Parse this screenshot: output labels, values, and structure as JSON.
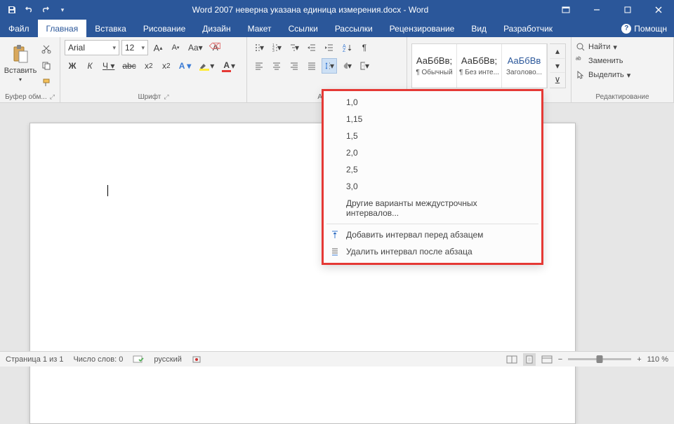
{
  "title": "Word 2007 неверна указана единица измерения.docx - Word",
  "tabs": [
    "Файл",
    "Главная",
    "Вставка",
    "Рисование",
    "Дизайн",
    "Макет",
    "Ссылки",
    "Рассылки",
    "Рецензирование",
    "Вид",
    "Разработчик"
  ],
  "help": "Помощн",
  "ribbon": {
    "clipboard": {
      "paste": "Вставить",
      "label": "Буфер обм..."
    },
    "font": {
      "name": "Arial",
      "size": "12",
      "label": "Шрифт"
    },
    "paragraph": {
      "label": "А..."
    },
    "styles": {
      "items": [
        {
          "preview": "АаБбВв;",
          "name": "¶ Обычный"
        },
        {
          "preview": "АаБбВв;",
          "name": "¶ Без инте..."
        },
        {
          "preview": "АаБбВв",
          "name": "Заголово..."
        }
      ]
    },
    "editing": {
      "find": "Найти",
      "replace": "Заменить",
      "select": "Выделить",
      "label": "Редактирование"
    }
  },
  "line_spacing_menu": {
    "options": [
      "1,0",
      "1,15",
      "1,5",
      "2,0",
      "2,5",
      "3,0"
    ],
    "more": "Другие варианты междустрочных интервалов...",
    "add_before": "Добавить интервал перед абзацем",
    "remove_after": "Удалить интервал после абзаца"
  },
  "status": {
    "page": "Страница 1 из 1",
    "words": "Число слов: 0",
    "lang": "русский",
    "zoom": "110 %"
  }
}
